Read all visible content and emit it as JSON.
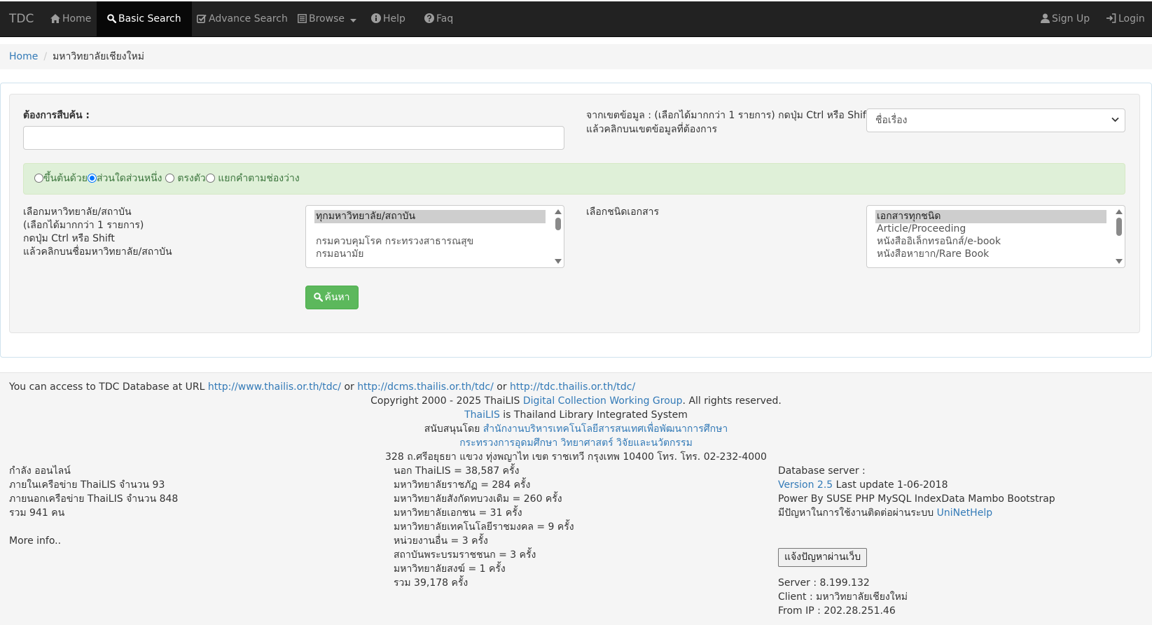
{
  "navbar": {
    "brand": "TDC",
    "home": "Home",
    "basic_search": "Basic Search",
    "advance_search": "Advance Search",
    "browse": "Browse",
    "help": "Help",
    "faq": "Faq",
    "sign_up": "Sign Up",
    "login": "Login",
    "active_item": "Basic Search"
  },
  "breadcrumb": {
    "home": "Home",
    "current": "มหาวิทยาลัยเชียงใหม่"
  },
  "search": {
    "query_label": "ต้องการสืบค้น :",
    "query_value": "",
    "field_label_line1": "จากเขตข้อมูล : (เลือกได้มากกว่า 1 รายการ) กดปุ่ม Ctrl หรือ Shift",
    "field_label_line2": "แล้วคลิกบนเขตข้อมูลที่ต้องการ",
    "field_selected": "ชื่อเรื่อง",
    "match_options": [
      {
        "label": "ขึ้นต้นด้วย",
        "checked": false
      },
      {
        "label": "ส่วนใดส่วนหนึ่ง",
        "checked": true
      },
      {
        "label": " ตรงตัว",
        "checked": false
      },
      {
        "label": " แยกคำตามช่องว่าง",
        "checked": false
      }
    ],
    "university_label_lines": [
      "เลือกมหาวิทยาลัย/สถาบัน",
      "(เลือกได้มากกว่า 1 รายการ)",
      "กดปุ่ม Ctrl หรือ Shift",
      "แล้วคลิกบนชื่อมหาวิทยาลัย/สถาบัน"
    ],
    "university_options": [
      {
        "label": "ทุกมหาวิทยาลัย/สถาบัน",
        "selected": true
      },
      {
        "label": "",
        "selected": false
      },
      {
        "label": "กรมควบคุมโรค กระทรวงสาธารณสุข",
        "selected": false
      },
      {
        "label": "กรมอนามัย",
        "selected": false
      }
    ],
    "doctype_label": "เลือกชนิดเอกสาร",
    "doctype_options": [
      {
        "label": "เอกสารทุกชนิด",
        "selected": true
      },
      {
        "label": "Article/Proceeding",
        "selected": false
      },
      {
        "label": "หนังสืออิเล็กทรอนิกส์/e-book",
        "selected": false
      },
      {
        "label": "หนังสือหายาก/Rare Book",
        "selected": false
      }
    ],
    "submit_label": "ค้นหา"
  },
  "footer": {
    "access_prefix": "You can access to TDC Database at URL ",
    "url1": "http://www.thailis.or.th/tdc/",
    "or1": " or ",
    "url2": "http://dcms.thailis.or.th/tdc/",
    "or2": " or ",
    "url3": "http://tdc.thailis.or.th/tdc/",
    "copyright_prefix": "Copyright 2000 - 2025 ThaiLIS ",
    "copyright_link": "Digital Collection Working Group",
    "copyright_suffix": ". All rights reserved.",
    "thailis_link": "ThaiLIS",
    "thailis_suffix": " is Thailand Library Integrated System",
    "support_prefix": "สนับสนุนโดย ",
    "support_link": "สำนักงานบริหารเทคโนโลยีสารสนเทศเพื่อพัฒนาการศึกษา",
    "ministry_link": "กระทรวงการอุดมศึกษา วิทยาศาสตร์ วิจัยและนวัตกรรม",
    "address": "328 ถ.ศรีอยุธยา แขวง ทุ่งพญาไท เขต ราชเทวี กรุงเทพ 10400 โทร. โทร. 02-232-4000",
    "online": {
      "title": "กำลัง ออนไลน์",
      "inside": "ภายในเครือข่าย ThaiLIS จำนวน 93",
      "outside": "ภายนอกเครือข่าย ThaiLIS จำนวน 848",
      "total": "รวม 941 คน",
      "more": "More info.."
    },
    "stats": [
      "นอก ThaiLIS = 38,587 ครั้ง",
      "มหาวิทยาลัยราชภัฏ = 284 ครั้ง",
      "มหาวิทยาลัยสังกัดทบวงเดิม = 260 ครั้ง",
      "มหาวิทยาลัยเอกชน = 31 ครั้ง",
      "มหาวิทยาลัยเทคโนโลยีราชมงคล = 9 ครั้ง",
      "หน่วยงานอื่น = 3 ครั้ง",
      "สถาบันพระบรมราชชนก = 3 ครั้ง",
      "มหาวิทยาลัยสงฆ์ = 1 ครั้ง",
      "รวม 39,178 ครั้ง"
    ],
    "server": {
      "db_label": "Database server :",
      "version_link": "Version 2.5",
      "last_update": " Last update 1-06-2018",
      "power": "Power By SUSE PHP MySQL IndexData Mambo Bootstrap",
      "problem_prefix": "มีปัญหาในการใช้งานติดต่อผ่านระบบ ",
      "problem_link": "UniNetHelp",
      "report_button": "แจ้งปัญหาผ่านเว็บ",
      "server": "Server : 8.199.132",
      "client": "Client : มหาวิทยาลัยเชียงใหม่",
      "from_ip": "From IP : 202.28.251.46"
    }
  },
  "colors": {
    "navbar_bg": "#222222",
    "navbar_active_bg": "#080808",
    "link": "#337ab7",
    "success_button": "#5cb85c",
    "alert_bg": "#dff0d8"
  }
}
